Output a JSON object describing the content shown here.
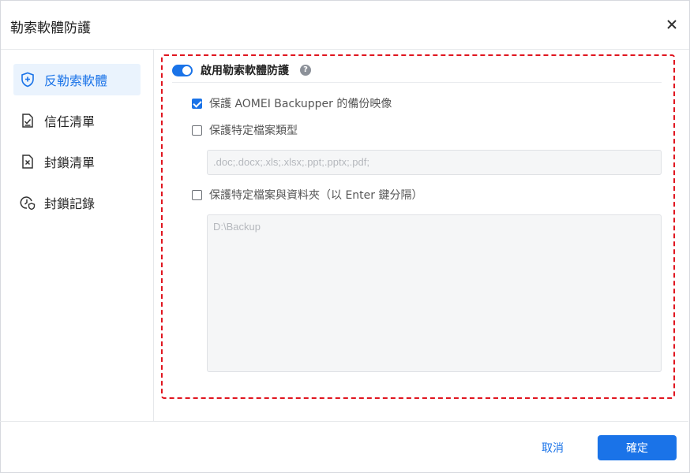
{
  "dialog": {
    "title": "勒索軟體防護",
    "close_icon": "close-icon"
  },
  "sidebar": {
    "items": [
      {
        "label": "反勒索軟體",
        "icon": "shield-plus-icon",
        "active": true
      },
      {
        "label": "信任清單",
        "icon": "document-check-icon",
        "active": false
      },
      {
        "label": "封鎖清單",
        "icon": "document-x-icon",
        "active": false
      },
      {
        "label": "封鎖記錄",
        "icon": "clock-shield-icon",
        "active": false
      }
    ]
  },
  "main": {
    "toggle_label": "啟用勒索軟體防護",
    "toggle_on": true,
    "help_glyph": "?",
    "options": [
      {
        "label": "保護 AOMEI Backupper 的備份映像",
        "checked": true
      },
      {
        "label": "保護特定檔案類型",
        "checked": false
      },
      {
        "label": "保護特定檔案與資料夾（以 Enter 鍵分隔）",
        "checked": false
      }
    ],
    "file_types_placeholder": ".doc;.docx;.xls;.xlsx;.ppt;.pptx;.pdf;",
    "folders_placeholder": "D:\\Backup"
  },
  "footer": {
    "cancel_label": "取消",
    "ok_label": "確定"
  },
  "colors": {
    "accent": "#1a73e8",
    "highlight_border": "#e0151f"
  }
}
